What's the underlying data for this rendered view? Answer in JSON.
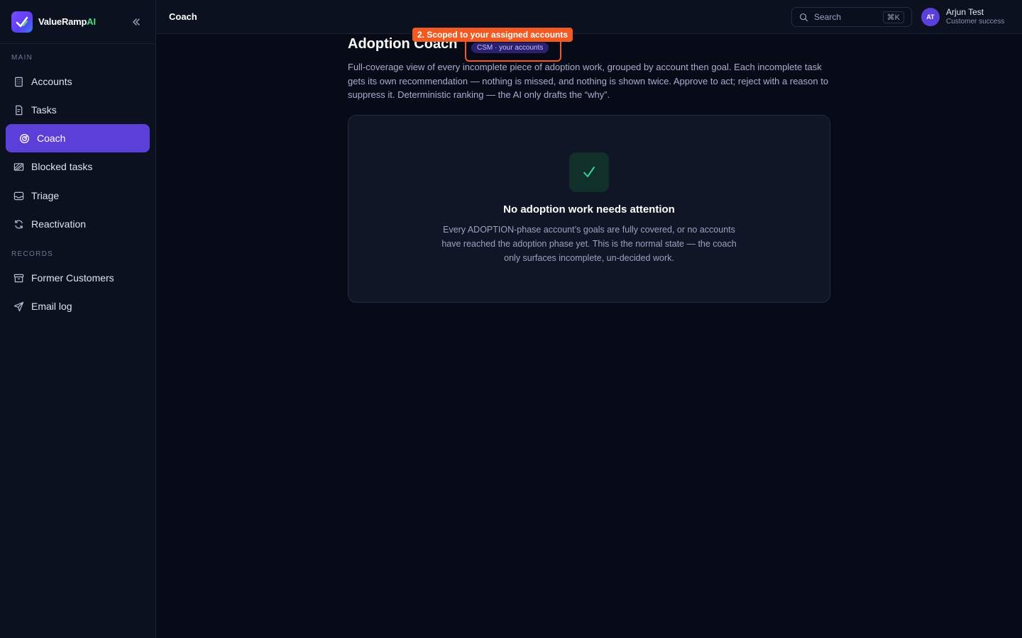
{
  "brand": {
    "name": "ValueRamp",
    "suffix": "AI"
  },
  "sidebar": {
    "sections": [
      {
        "label": "MAIN"
      },
      {
        "label": "RECORDS"
      }
    ],
    "items": [
      {
        "label": "Accounts",
        "icon": "building-icon"
      },
      {
        "label": "Tasks",
        "icon": "clipboard-icon"
      },
      {
        "label": "Coach",
        "icon": "target-icon",
        "active": true
      },
      {
        "label": "Blocked tasks",
        "icon": "blocked-icon"
      },
      {
        "label": "Triage",
        "icon": "inbox-icon"
      },
      {
        "label": "Reactivation",
        "icon": "refresh-icon"
      },
      {
        "label": "Former Customers",
        "icon": "archive-icon"
      },
      {
        "label": "Email log",
        "icon": "send-icon"
      }
    ]
  },
  "topbar": {
    "title": "Coach",
    "search_placeholder": "Search",
    "search_shortcut": "⌘K"
  },
  "user": {
    "initials": "AT",
    "name": "Arjun Test",
    "role": "Customer success"
  },
  "main": {
    "title": "Adoption Coach",
    "badge": "CSM · your accounts",
    "description": "Full-coverage view of every incomplete piece of adoption work, grouped by account then goal. Each incomplete task gets its own recommendation — nothing is missed, and nothing is shown twice. Approve to act; reject with a reason to suppress it. Deterministic ranking — the AI only drafts the “why”.",
    "empty_title": "No adoption work needs attention",
    "empty_body": "Every ADOPTION-phase account’s goals are fully covered, or no accounts have reached the adoption phase yet. This is the normal state — the coach only surfaces incomplete, un-decided work."
  },
  "callout": {
    "text": "2. Scoped to your assigned accounts"
  },
  "colors": {
    "accent": "#5b3fd9",
    "callout": "#f15a22",
    "success": "#34d399"
  }
}
